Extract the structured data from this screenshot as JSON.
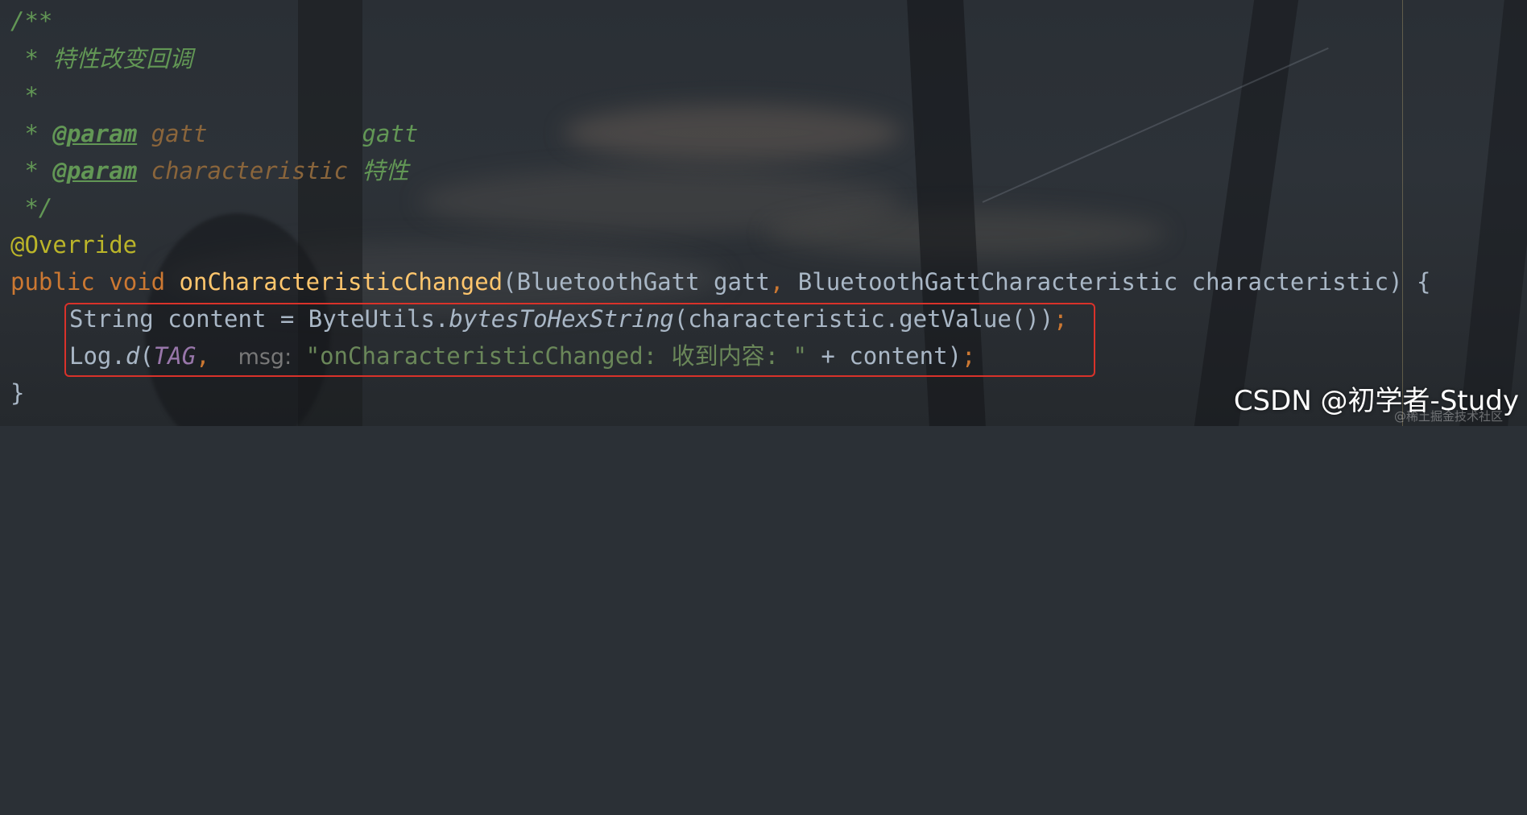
{
  "code": {
    "doc_open": "/**",
    "doc_title_prefix": " * ",
    "doc_title": "特性改变回调",
    "doc_blank": " *",
    "param_prefix": " * ",
    "param_tag": "@param",
    "param1_name": "gatt",
    "param1_desc": "gatt",
    "param2_name": "characteristic",
    "param2_desc": "特性",
    "doc_close": " */",
    "annotation": "@Override",
    "kw_public": "public",
    "kw_void": "void",
    "method_name": "onCharacteristicChanged",
    "sig_params": "(BluetoothGatt gatt",
    "sig_comma": ",",
    "sig_params2": " BluetoothGattCharacteristic characteristic) {",
    "l1_decl": "String content = ByteUtils.",
    "l1_static": "bytesToHexString",
    "l1_args": "(characteristic.getValue())",
    "l1_semi": ";",
    "l2_log": "Log.",
    "l2_d": "d",
    "l2_open": "(",
    "l2_tag": "TAG",
    "l2_comma": ",",
    "l2_hint": "msg:",
    "l2_string": "\"onCharacteristicChanged: 收到内容: \"",
    "l2_concat": " + content)",
    "l2_semi": ";",
    "close_brace": "}"
  },
  "watermark": {
    "main": "CSDN @初学者-Study",
    "sub": "@稀土掘金技术社区"
  },
  "colors": {
    "comment": "#629755",
    "keyword": "#cc7832",
    "method": "#ffc66d",
    "plain": "#a9b7c6",
    "annotation": "#bbb529",
    "string": "#6a8759",
    "constant": "#9876aa",
    "highlight_border": "#d9322a"
  }
}
